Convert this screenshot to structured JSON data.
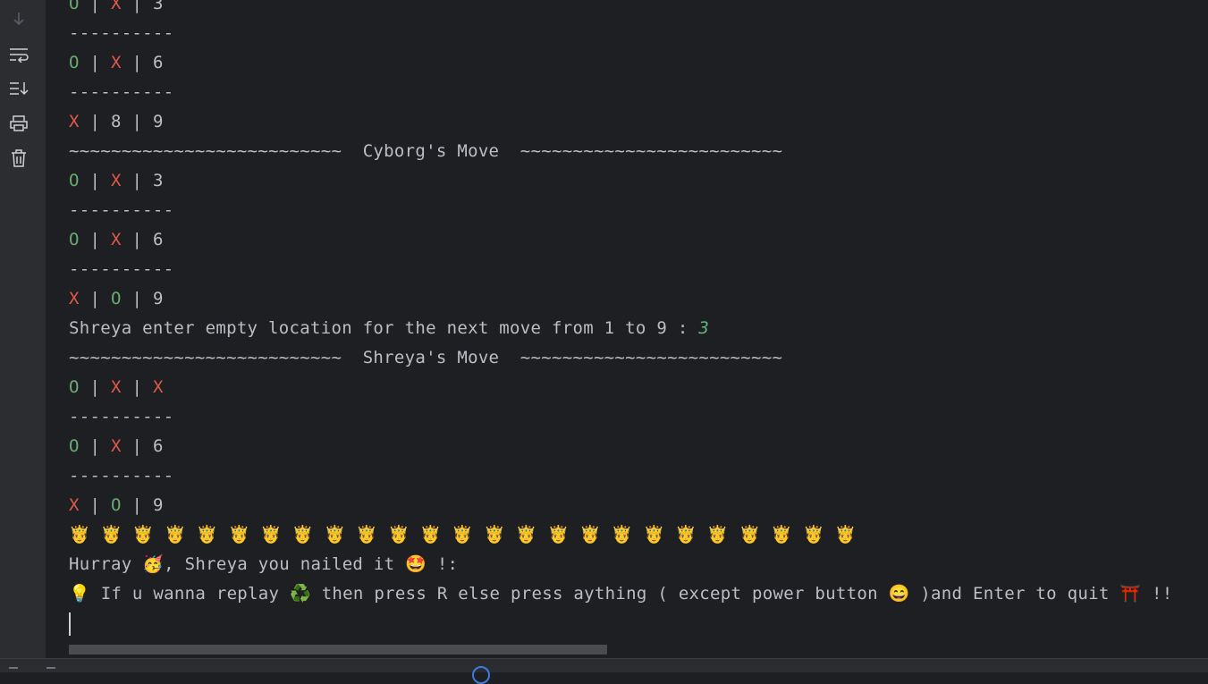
{
  "gutter": {
    "icons": [
      "arrow-down-icon",
      "soft-wrap-icon",
      "scroll-to-end-icon",
      "print-icon",
      "trash-icon"
    ]
  },
  "symbols": {
    "sep": " | ",
    "o": "O",
    "x": "X"
  },
  "console": {
    "l1_c3": "3",
    "divider": "----------",
    "l3_c3": "6",
    "l5_c2": "8",
    "l5_c3": "9",
    "cyborg_banner": "~~~~~~~~~~~~~~~~~~~~~~~~~~  Cyborg's Move  ~~~~~~~~~~~~~~~~~~~~~~~~~",
    "l7_c3": "3",
    "l9_c3": "6",
    "l11_c3": "9",
    "prompt": "Shreya enter empty location for the next move from 1 to 9 : ",
    "prompt_input": "3",
    "shreya_banner": "~~~~~~~~~~~~~~~~~~~~~~~~~~  Shreya's Move  ~~~~~~~~~~~~~~~~~~~~~~~~~",
    "l16_c3": "6",
    "l18_c3": "9",
    "crowns": "🤴 🤴 🤴 🤴 🤴 🤴 🤴 🤴 🤴 🤴 🤴 🤴 🤴 🤴 🤴 🤴 🤴 🤴 🤴 🤴 🤴 🤴 🤴 🤴 🤴",
    "hurray": "Hurray 🥳, Shreya you nailed it 🤩 !:",
    "replay": "💡 If u wanna replay ♻️ then press R else press aything ( except power button 😄 )and Enter to quit ⛩️ !!"
  },
  "colors": {
    "background": "#1e1f22",
    "gutter": "#2b2d30",
    "text": "#bcbec4",
    "o_mark": "#6aab73",
    "x_mark": "#e0584c",
    "user_input": "#5fb878"
  }
}
